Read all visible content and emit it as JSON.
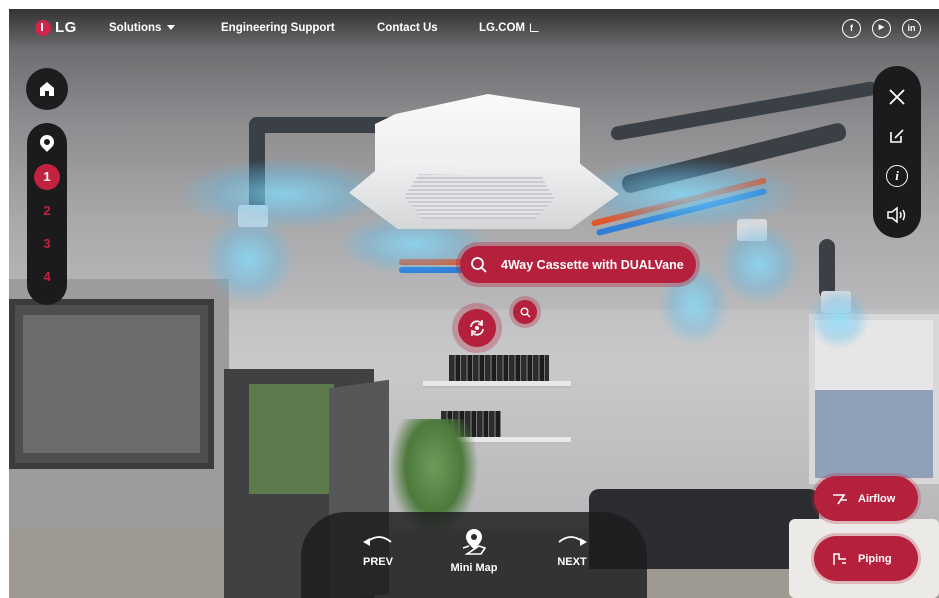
{
  "brand": {
    "logo_text": "LG",
    "accent_color": "#b5203c"
  },
  "nav": {
    "solutions": "Solutions",
    "engineering_support": "Engineering Support",
    "contact_us": "Contact Us",
    "lg_com": "LG.COM"
  },
  "social": {
    "facebook": "f",
    "youtube": "▶",
    "linkedin": "in"
  },
  "locations": {
    "items": [
      "1",
      "2",
      "3",
      "4"
    ],
    "active": "1"
  },
  "hotspot": {
    "label": "4Way Cassette with DUALVane"
  },
  "bottom_nav": {
    "prev": "PREV",
    "mini_map": "Mini Map",
    "next": "NEXT"
  },
  "actions": {
    "airflow": "Airflow",
    "piping": "Piping"
  },
  "right_tools": {
    "info": "i"
  }
}
